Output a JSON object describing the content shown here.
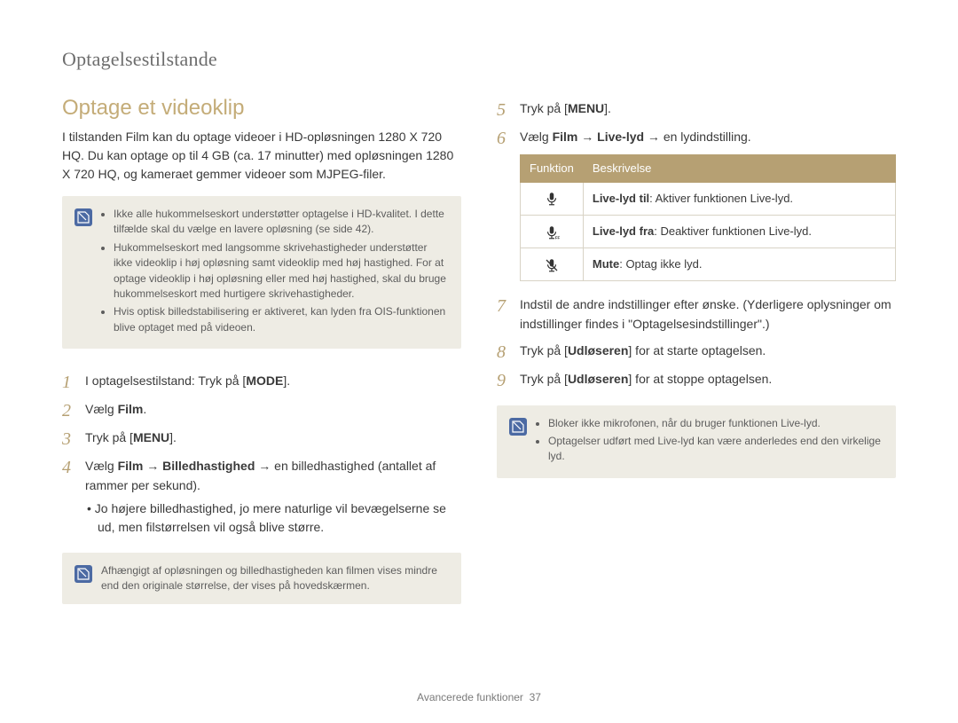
{
  "section_header": "Optagelsestilstande",
  "title": "Optage et videoklip",
  "intro": "I tilstanden Film kan du optage videoer i HD-opløsningen 1280 X 720 HQ. Du kan optage op til 4 GB (ca. 17 minutter) med opløsningen 1280 X 720 HQ, og kameraet gemmer videoer som MJPEG-filer.",
  "note1": {
    "items": [
      "Ikke alle hukommelseskort understøtter optagelse i HD-kvalitet. I dette tilfælde skal du vælge en lavere opløsning (se side 42).",
      "Hukommelseskort med langsomme skrivehastigheder understøtter ikke videoklip i høj opløsning samt videoklip med høj hastighed. For at optage videoklip i høj opløsning eller med høj hastighed, skal du bruge hukommelseskort med hurtigere skrivehastigheder.",
      "Hvis optisk billedstabilisering er aktiveret, kan lyden fra OIS-funktionen blive optaget med på videoen."
    ]
  },
  "steps_left": {
    "s1_pre": "I optagelsestilstand: Tryk på [",
    "s1_mode": "MODE",
    "s1_post": "].",
    "s2_pre": "Vælg ",
    "s2_film": "Film",
    "s2_post": ".",
    "s3_pre": "Tryk på [",
    "s3_menu": "MENU",
    "s3_post": "].",
    "s4_main_a": "Vælg ",
    "s4_film": "Film",
    "s4_arrow1": " → ",
    "s4_bille": "Billedhastighed",
    "s4_arrow2": " → en billedhastighed (antallet af rammer per sekund).",
    "s4_bullet": "Jo højere billedhastighed, jo mere naturlige vil bevægelserne se ud, men filstørrelsen vil også blive større."
  },
  "note2": {
    "text": "Afhængigt af opløsningen og billedhastigheden kan filmen vises mindre end den originale størrelse, der vises på hovedskærmen."
  },
  "steps_right": {
    "s5_pre": "Tryk på [",
    "s5_menu": "MENU",
    "s5_post": "].",
    "s6_a": "Vælg ",
    "s6_film": "Film",
    "s6_arrow1": " → ",
    "s6_live": "Live-lyd",
    "s6_arrow2": " → en lydindstilling.",
    "s7": "Indstil de andre indstillinger efter  ønske. (Yderligere oplysninger om indstillinger findes i \"Optagelsesindstillinger\".)",
    "s8_pre": "Tryk på [",
    "s8_udl": "Udløseren",
    "s8_post": "] for at starte optagelsen.",
    "s9_pre": "Tryk på [",
    "s9_udl": "Udløseren",
    "s9_post": "] for at stoppe optagelsen."
  },
  "table": {
    "head_funktion": "Funktion",
    "head_beskrivelse": "Beskrivelse",
    "row1_label": "Live-lyd til",
    "row1_desc": ": Aktiver funktionen Live-lyd.",
    "row2_label": "Live-lyd fra",
    "row2_desc": ": Deaktiver funktionen Live-lyd.",
    "row3_label": "Mute",
    "row3_desc": ": Optag ikke lyd."
  },
  "note3": {
    "items": [
      "Bloker ikke mikrofonen, når du bruger funktionen Live-lyd.",
      "Optagelser udført med Live-lyd kan være anderledes end den virkelige lyd."
    ]
  },
  "footer_text": "Avancerede funktioner",
  "footer_page": "37"
}
